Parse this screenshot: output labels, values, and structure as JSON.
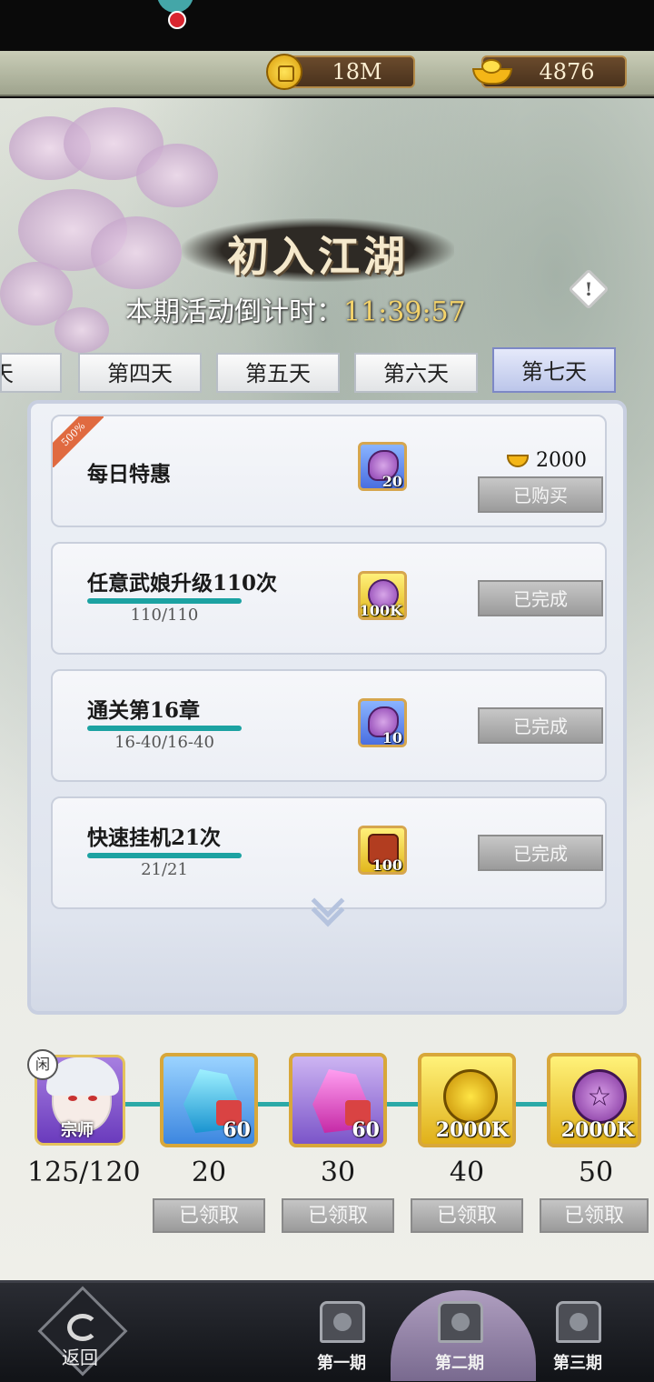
{
  "currency": {
    "coins": "18M",
    "ingots": "4876"
  },
  "event": {
    "title": "初入江湖",
    "countdown_label": "本期活动倒计时：",
    "countdown_value": "11:39:57"
  },
  "tabs": [
    {
      "label": "第三天",
      "active": false
    },
    {
      "label": "第四天",
      "active": false
    },
    {
      "label": "第五天",
      "active": false
    },
    {
      "label": "第六天",
      "active": false
    },
    {
      "label": "第七天",
      "active": true
    }
  ],
  "tasks": [
    {
      "title": "每日特惠",
      "badge": "500%",
      "reward_qty": "20",
      "price": "2000",
      "button": "已购买"
    },
    {
      "title": "任意武娘升级110次",
      "progress": "110/110",
      "reward_qty": "100K",
      "button": "已完成"
    },
    {
      "title": "通关第16章",
      "progress": "16-40/16-40",
      "reward_qty": "10",
      "button": "已完成"
    },
    {
      "title": "快速挂机21次",
      "progress": "21/21",
      "reward_qty": "100",
      "button": "已完成"
    }
  ],
  "milestones": {
    "avatar_label": "宗师",
    "avatar_tag": "闲",
    "score": "125/120",
    "rewards": [
      {
        "qty": "60",
        "threshold": "20",
        "button": "已领取"
      },
      {
        "qty": "60",
        "threshold": "30",
        "button": "已领取"
      },
      {
        "qty": "2000K",
        "threshold": "40",
        "button": "已领取"
      },
      {
        "qty": "2000K",
        "threshold": "50",
        "button": "已领取"
      }
    ]
  },
  "bottom_nav": {
    "back": "返回",
    "periods": [
      "第一期",
      "第二期",
      "第三期"
    ]
  },
  "info_icon": "!"
}
